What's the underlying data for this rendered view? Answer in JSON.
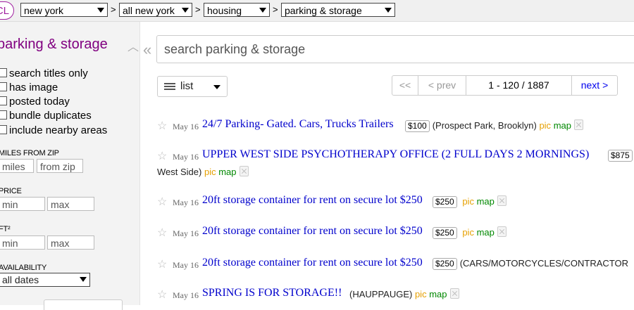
{
  "logo": "CL",
  "breadcrumbs": {
    "site": "new york",
    "area": "all new york",
    "category": "housing",
    "subcategory": "parking & storage",
    "separator": ">"
  },
  "sidebar": {
    "title": "parking & storage",
    "checkboxes": [
      "search titles only",
      "has image",
      "posted today",
      "bundle duplicates",
      "include nearby areas"
    ],
    "miles_label": "MILES FROM ZIP",
    "miles_placeholder": "miles",
    "zip_placeholder": "from zip",
    "price_label": "PRICE",
    "price_min": "min",
    "price_max": "max",
    "ft_label": "FT²",
    "ft_min": "min",
    "ft_max": "max",
    "availability_label": "AVAILABILITY",
    "availability_value": "all dates"
  },
  "search": {
    "placeholder": "search parking & storage"
  },
  "view": {
    "label": "list"
  },
  "pager": {
    "first": "<<",
    "prev": "< prev",
    "range": "1 - 120 / 1887",
    "next": "next >"
  },
  "results": [
    {
      "date": "May 16",
      "title": "24/7 Parking- Gated. Cars, Trucks Trailers",
      "price": "$100",
      "location": "(Prospect Park, Brooklyn)",
      "pic": "pic",
      "map": "map"
    },
    {
      "date": "May 16",
      "title": "UPPER WEST SIDE PSYCHOTHERAPY OFFICE (2 FULL DAYS 2 MORNINGS)",
      "price": "$875",
      "location": "West Side)",
      "pic": "pic",
      "map": "map"
    },
    {
      "date": "May 16",
      "title": "20ft storage container for rent on secure lot $250",
      "price": "$250",
      "location": "",
      "pic": "pic",
      "map": "map"
    },
    {
      "date": "May 16",
      "title": "20ft storage container for rent on secure lot $250",
      "price": "$250",
      "location": "",
      "pic": "pic",
      "map": "map"
    },
    {
      "date": "May 16",
      "title": "20ft storage container for rent on secure lot $250",
      "price": "$250",
      "location": "(CARS/MOTORCYCLES/CONTRACTOR",
      "pic": "",
      "map": ""
    },
    {
      "date": "May 16",
      "title": "SPRING IS FOR STORAGE!!",
      "price": "",
      "location": "(HAUPPAUGE)",
      "pic": "pic",
      "map": "map"
    }
  ],
  "colors": {
    "title_purple": "#800080",
    "link_blue": "#0000cc",
    "pic_orange": "#e6a000",
    "map_green": "#008800"
  }
}
